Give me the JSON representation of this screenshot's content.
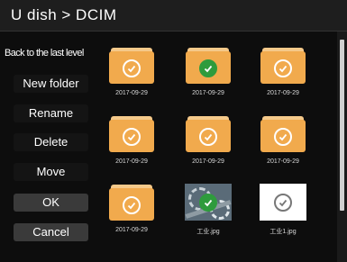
{
  "header": {
    "title": "U dish > DCIM"
  },
  "sidebar": {
    "back_label": "Back to the last level",
    "buttons": [
      "New folder",
      "Rename",
      "Delete",
      "Move",
      "OK",
      "Cancel"
    ]
  },
  "grid": {
    "items": [
      {
        "type": "folder",
        "label": "2017-09-29",
        "selected": false
      },
      {
        "type": "folder",
        "label": "2017-09-29",
        "selected": true
      },
      {
        "type": "folder",
        "label": "2017-09-29",
        "selected": false
      },
      {
        "type": "folder",
        "label": "2017-09-29",
        "selected": false
      },
      {
        "type": "folder",
        "label": "2017-09-29",
        "selected": false
      },
      {
        "type": "folder",
        "label": "2017-09-29",
        "selected": false
      },
      {
        "type": "folder",
        "label": "2017-09-29",
        "selected": false
      },
      {
        "type": "image",
        "label": "工业.jpg",
        "selected": true
      },
      {
        "type": "image",
        "label": "工业1.jpg",
        "selected": false
      }
    ]
  },
  "colors": {
    "folder": "#f1aa4d",
    "folder_tab": "#f5c98a",
    "check_selected": "#2e9b3c",
    "background": "#0d0d0d"
  }
}
